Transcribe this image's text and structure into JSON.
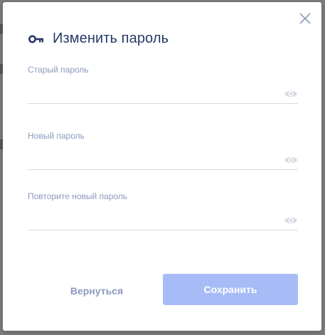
{
  "dialog": {
    "title": "Изменить пароль",
    "title_icon": "key-icon",
    "close_icon": "close-icon",
    "colors": {
      "title": "#263a67",
      "label": "#8c9abc",
      "primary_button": "#a7bcf7"
    }
  },
  "fields": [
    {
      "label": "Старый пароль",
      "value": "",
      "visibility_icon": "eye-icon"
    },
    {
      "label": "Новый пароль",
      "value": "",
      "visibility_icon": "eye-icon"
    },
    {
      "label": "Повторите новый пароль",
      "value": "",
      "visibility_icon": "eye-icon"
    }
  ],
  "actions": {
    "back_label": "Вернуться",
    "save_label": "Сохранить"
  }
}
